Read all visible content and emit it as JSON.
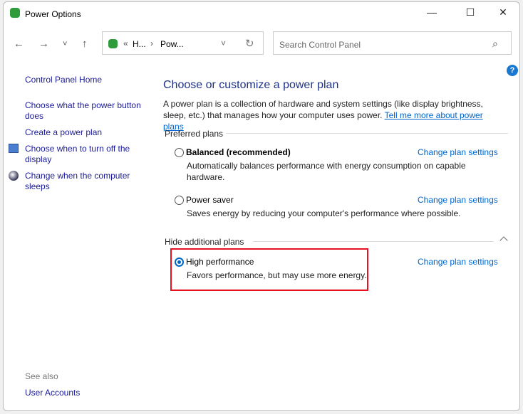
{
  "window": {
    "title": "Power Options",
    "minimize": "—",
    "maximize": "☐",
    "close": "✕"
  },
  "nav": {
    "back": "←",
    "forward": "→",
    "recent": "˅",
    "up": "↑",
    "refresh": "↻"
  },
  "address": {
    "overflow": "«",
    "crumbs": [
      "H...",
      "Pow..."
    ],
    "sep": "›",
    "dropdown": "˅"
  },
  "search": {
    "placeholder": "Search Control Panel",
    "icon": "⌕"
  },
  "help": "?",
  "sidebar": {
    "home": "Control Panel Home",
    "items": [
      "Choose what the power button does",
      "Create a power plan",
      "Choose when to turn off the display",
      "Change when the computer sleeps"
    ],
    "see_also": "See also",
    "user_accounts": "User Accounts"
  },
  "main": {
    "heading": "Choose or customize a power plan",
    "intro": "A power plan is a collection of hardware and system settings (like display brightness, sleep, etc.) that manages how your computer uses power. ",
    "intro_link": "Tell me more about power plans",
    "preferred": "Preferred plans",
    "hide": "Hide additional plans",
    "plans": [
      {
        "name": "Balanced (recommended)",
        "desc": "Automatically balances performance with energy consumption on capable hardware.",
        "link": "Change plan settings",
        "selected": false
      },
      {
        "name": "Power saver",
        "desc": "Saves energy by reducing your computer's performance where possible.",
        "link": "Change plan settings",
        "selected": false
      },
      {
        "name": "High performance",
        "desc": "Favors performance, but may use more energy.",
        "link": "Change plan settings",
        "selected": true
      }
    ]
  },
  "colors": {
    "highlight": "#e81123",
    "accent": "#0067c0"
  }
}
